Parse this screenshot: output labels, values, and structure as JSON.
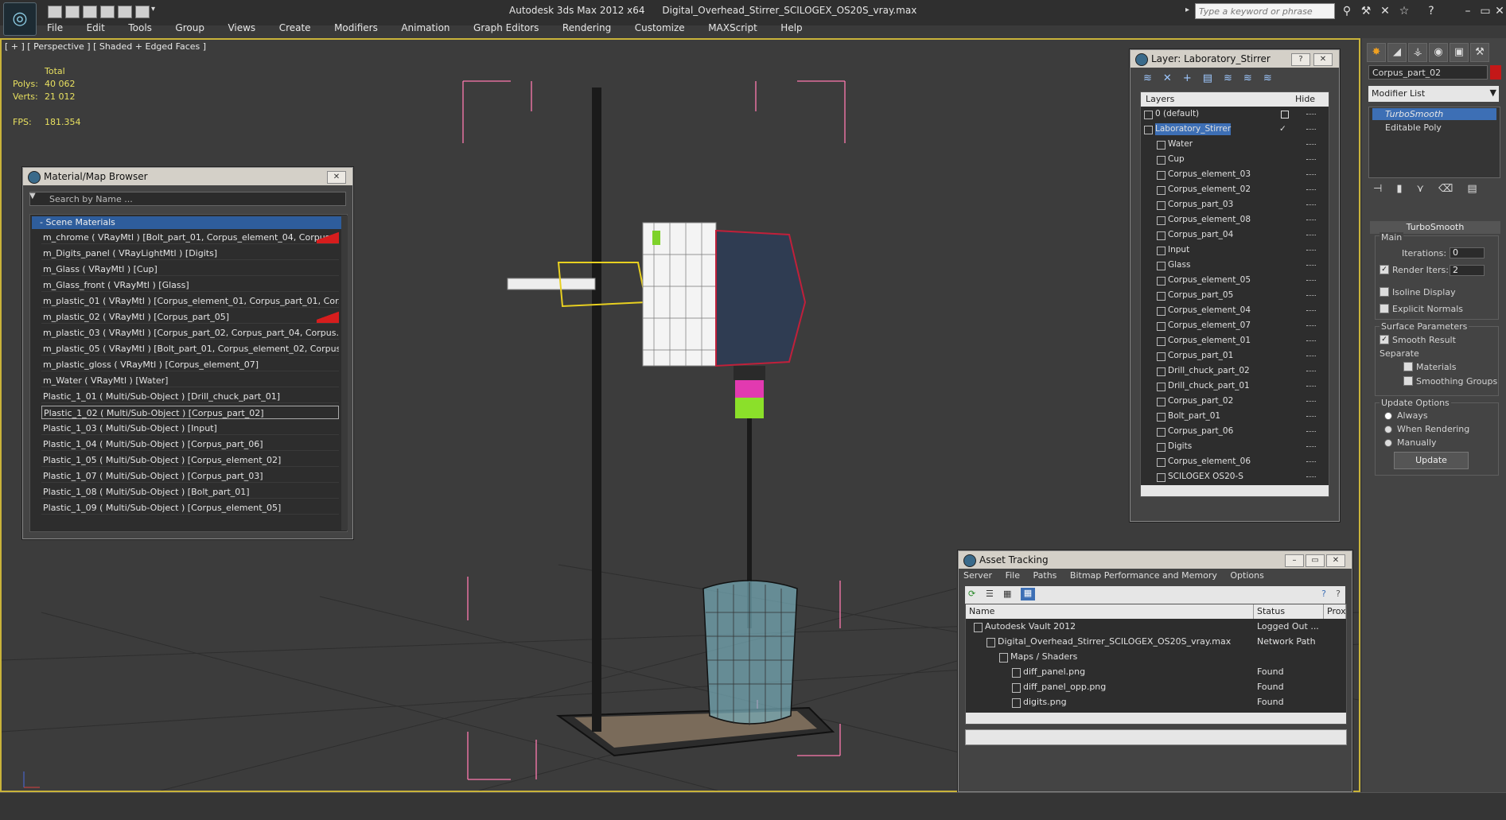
{
  "app": {
    "title": "Autodesk 3ds Max  2012 x64",
    "file": "Digital_Overhead_Stirrer_SCILOGEX_OS20S_vray.max",
    "search_placeholder": "Type a keyword or phrase"
  },
  "menu": [
    "File",
    "Edit",
    "Tools",
    "Group",
    "Views",
    "Create",
    "Modifiers",
    "Animation",
    "Graph Editors",
    "Rendering",
    "Customize",
    "MAXScript",
    "Help"
  ],
  "viewport": {
    "label": "[ + ] [ Perspective ] [ Shaded + Edged Faces ]",
    "stats": {
      "total_label": "Total",
      "polys_label": "Polys:",
      "polys": "40 062",
      "verts_label": "Verts:",
      "verts": "21 012",
      "fps_label": "FPS:",
      "fps": "181.354"
    }
  },
  "material_browser": {
    "title": "Material/Map Browser",
    "search_placeholder": "Search by Name ...",
    "section": "- Scene Materials",
    "items": [
      "m_chrome  ( VRayMtl ) [Bolt_part_01, Corpus_element_04, Corpus_e...",
      "m_Digits_panel  ( VRayLightMtl ) [Digits]",
      "m_Glass  ( VRayMtl ) [Cup]",
      "m_Glass_front  ( VRayMtl ) [Glass]",
      "m_plastic_01  ( VRayMtl ) [Corpus_element_01, Corpus_part_01, Cor...",
      "m_plastic_02  ( VRayMtl ) [Corpus_part_05]",
      "m_plastic_03  ( VRayMtl ) [Corpus_part_02, Corpus_part_04, Corpus...",
      "m_plastic_05  ( VRayMtl ) [Bolt_part_01, Corpus_element_02, Corpus...",
      "m_plastic_gloss  ( VRayMtl ) [Corpus_element_07]",
      "m_Water  ( VRayMtl ) [Water]",
      "Plastic_1_01  ( Multi/Sub-Object ) [Drill_chuck_part_01]",
      "Plastic_1_02  ( Multi/Sub-Object ) [Corpus_part_02]",
      "Plastic_1_03  ( Multi/Sub-Object ) [Input]",
      "Plastic_1_04  ( Multi/Sub-Object ) [Corpus_part_06]",
      "Plastic_1_05  ( Multi/Sub-Object ) [Corpus_element_02]",
      "Plastic_1_07  ( Multi/Sub-Object ) [Corpus_part_03]",
      "Plastic_1_08  ( Multi/Sub-Object ) [Bolt_part_01]",
      "Plastic_1_09  ( Multi/Sub-Object ) [Corpus_element_05]"
    ]
  },
  "layer_window": {
    "title": "Layer: Laboratory_Stirrer",
    "col_layers": "Layers",
    "col_hide": "Hide",
    "layers": [
      "0 (default)",
      "Laboratory_Stirrer",
      "Water",
      "Cup",
      "Corpus_element_03",
      "Corpus_element_02",
      "Corpus_part_03",
      "Corpus_element_08",
      "Corpus_part_04",
      "Input",
      "Glass",
      "Corpus_element_05",
      "Corpus_part_05",
      "Corpus_element_04",
      "Corpus_element_07",
      "Corpus_element_01",
      "Corpus_part_01",
      "Drill_chuck_part_02",
      "Drill_chuck_part_01",
      "Corpus_part_02",
      "Bolt_part_01",
      "Corpus_part_06",
      "Digits",
      "Corpus_element_06",
      "SCILOGEX OS20-S"
    ]
  },
  "asset_tracking": {
    "title": "Asset Tracking",
    "menu": [
      "Server",
      "File",
      "Paths",
      "Bitmap Performance and Memory",
      "Options"
    ],
    "col_name": "Name",
    "col_status": "Status",
    "col_proxy": "Prox",
    "rows": [
      {
        "name": "Autodesk Vault 2012",
        "status": "Logged Out ..."
      },
      {
        "name": "Digital_Overhead_Stirrer_SCILOGEX_OS20S_vray.max",
        "status": "Network Path"
      },
      {
        "name": "Maps / Shaders",
        "status": ""
      },
      {
        "name": "diff_panel.png",
        "status": "Found"
      },
      {
        "name": "diff_panel_opp.png",
        "status": "Found"
      },
      {
        "name": "digits.png",
        "status": "Found"
      }
    ]
  },
  "command_panel": {
    "object_name": "Corpus_part_02",
    "object_color": "#c41818",
    "modifier_list": "Modifier List",
    "stack": [
      "TurboSmooth",
      "Editable Poly"
    ],
    "rollout_title": "TurboSmooth",
    "main_label": "Main",
    "iterations_label": "Iterations:",
    "iterations": "0",
    "render_iters_label": "Render Iters:",
    "render_iters": "2",
    "isoline": "Isoline Display",
    "explicit": "Explicit Normals",
    "surface_label": "Surface Parameters",
    "smooth_result": "Smooth Result",
    "separate_label": "Separate",
    "materials": "Materials",
    "smoothing_groups": "Smoothing Groups",
    "update_label": "Update Options",
    "always": "Always",
    "when_rendering": "When Rendering",
    "manually": "Manually",
    "update_button": "Update"
  }
}
